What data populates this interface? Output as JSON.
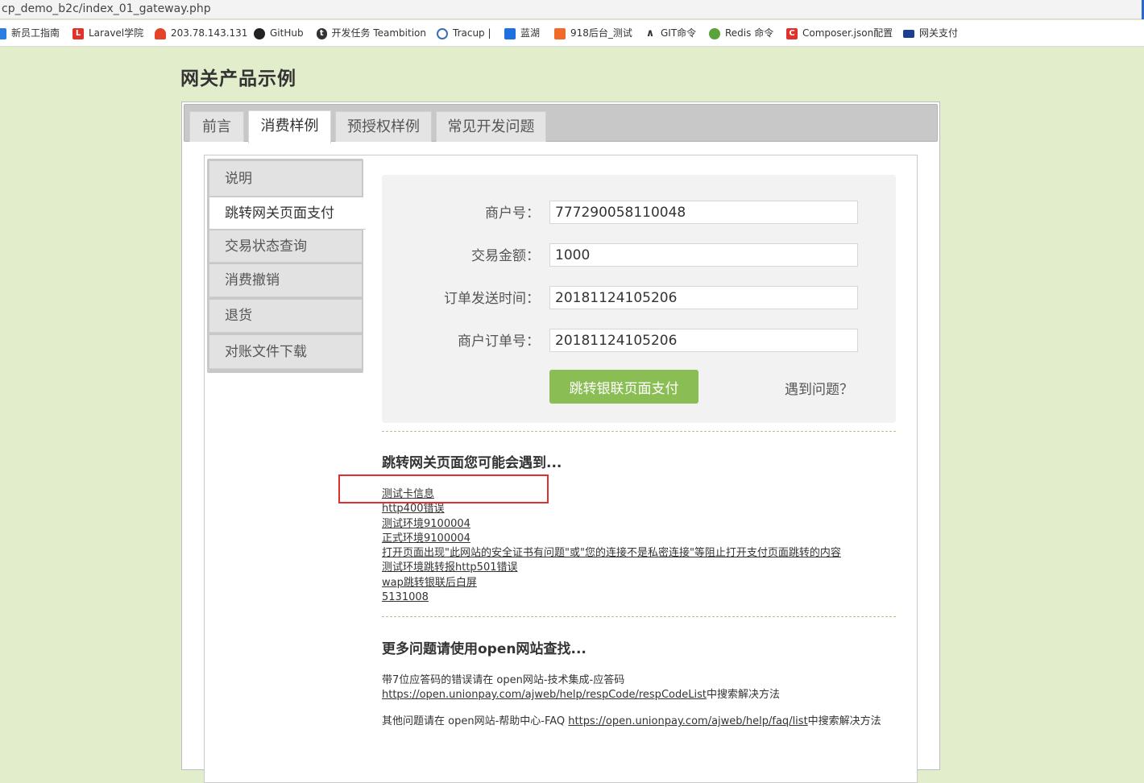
{
  "browser": {
    "url": "cp_demo_b2c/index_01_gateway.php",
    "bookmarks": [
      {
        "label": "新员工指南",
        "icon": "bookmark-icon",
        "color": "#2a7de1"
      },
      {
        "label": "Laravel学院",
        "icon": "laravel-icon",
        "color": "#e0312b"
      },
      {
        "label": "203.78.143.131",
        "icon": "gitlab-icon",
        "color": "#e2432a"
      },
      {
        "label": "GitHub",
        "icon": "github-icon",
        "color": "#222222"
      },
      {
        "label": "开发任务 Teambition",
        "icon": "teambition-icon",
        "color": "#333333"
      },
      {
        "label": "Tracup |",
        "icon": "tracup-icon",
        "color": "#3a6fb0"
      },
      {
        "label": "蓝湖",
        "icon": "lanhu-icon",
        "color": "#1f6fe0"
      },
      {
        "label": "918后台_测试",
        "icon": "admin-icon",
        "color": "#f06a28"
      },
      {
        "label": "GIT命令",
        "icon": "git-icon",
        "color": "#333333"
      },
      {
        "label": "Redis 命令",
        "icon": "redis-icon",
        "color": "#5aa23a"
      },
      {
        "label": "Composer.json配置",
        "icon": "composer-icon",
        "color": "#e0312b"
      },
      {
        "label": "网关支付",
        "icon": "card-icon",
        "color": "#1d3f8f"
      }
    ]
  },
  "page": {
    "title": "网关产品示例",
    "tabs": [
      {
        "label": "前言",
        "active": false
      },
      {
        "label": "消费样例",
        "active": true
      },
      {
        "label": "预授权样例",
        "active": false
      },
      {
        "label": "常见开发问题",
        "active": false
      }
    ],
    "sidenav": [
      {
        "label": "说明",
        "active": false
      },
      {
        "label": "跳转网关页面支付",
        "active": true
      },
      {
        "label": "交易状态查询",
        "active": false
      },
      {
        "label": "消费撤销",
        "active": false
      },
      {
        "label": "退货",
        "active": false
      },
      {
        "label": "对账文件下载",
        "active": false
      }
    ],
    "form": {
      "fields": [
        {
          "label": "商户号：",
          "value": "777290058110048"
        },
        {
          "label": "交易金额：",
          "value": "1000"
        },
        {
          "label": "订单发送时间：",
          "value": "20181124105206"
        },
        {
          "label": "商户订单号：",
          "value": "20181124105206"
        }
      ],
      "submit_label": "跳转银联页面支付",
      "problem_label": "遇到问题？"
    },
    "faq": {
      "title": "跳转网关页面您可能会遇到...",
      "links": [
        "测试卡信息",
        "http400错误",
        "测试环境9100004",
        "正式环境9100004",
        "打开页面出现\"此网站的安全证书有问题\"或\"您的连接不是私密连接\"等阻止打开支付页面跳转的内容",
        "测试环境跳转报http501错误",
        "wap跳转银联后白屏",
        "5131008"
      ]
    },
    "more": {
      "title": "更多问题请使用open网站查找...",
      "para1_prefix": "带7位应答码的错误请在 open网站-技术集成-应答码",
      "para1_link": "https://open.unionpay.com/ajweb/help/respCode/respCodeList",
      "para1_suffix": "中搜索解决方法",
      "para2_prefix": "其他问题请在 open网站-帮助中心-FAQ ",
      "para2_link": "https://open.unionpay.com/ajweb/help/faq/list",
      "para2_suffix": "中搜索解决方法"
    }
  },
  "colors": {
    "page_background": "#e2edcc",
    "submit_button": "#8bbd55",
    "highlight_box": "#e02f2f"
  }
}
